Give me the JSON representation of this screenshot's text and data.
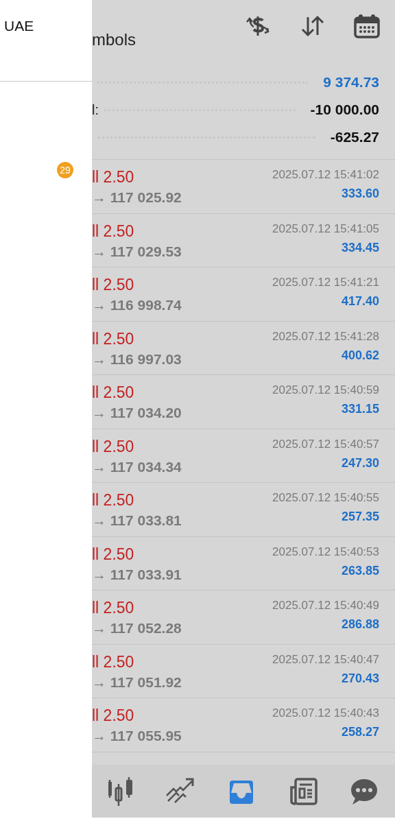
{
  "drawer": {
    "title": "UAE",
    "badge": "29"
  },
  "header": {
    "title": "mbols",
    "actions": [
      {
        "kind": "currency"
      },
      {
        "kind": "sort"
      },
      {
        "kind": "calendar"
      }
    ]
  },
  "summary": [
    {
      "value": "9 374.73",
      "kind": "accent"
    },
    {
      "label": "l:",
      "value": "-10 000.00",
      "kind": "plain"
    },
    {
      "value": "-625.27",
      "kind": "plain"
    }
  ],
  "trades": [
    {
      "type": "ll 2.50",
      "prices": "→ 117 025.92",
      "time": "2025.07.12 15:41:02",
      "profit": "333.60"
    },
    {
      "type": "ll 2.50",
      "prices": "→ 117 029.53",
      "time": "2025.07.12 15:41:05",
      "profit": "334.45"
    },
    {
      "type": "ll 2.50",
      "prices": "→ 116 998.74",
      "time": "2025.07.12 15:41:21",
      "profit": "417.40"
    },
    {
      "type": "ll 2.50",
      "prices": "→ 116 997.03",
      "time": "2025.07.12 15:41:28",
      "profit": "400.62"
    },
    {
      "type": "ll 2.50",
      "prices": "→ 117 034.20",
      "time": "2025.07.12 15:40:59",
      "profit": "331.15"
    },
    {
      "type": "ll 2.50",
      "prices": "→ 117 034.34",
      "time": "2025.07.12 15:40:57",
      "profit": "247.30"
    },
    {
      "type": "ll 2.50",
      "prices": "→ 117 033.81",
      "time": "2025.07.12 15:40:55",
      "profit": "257.35"
    },
    {
      "type": "ll 2.50",
      "prices": "→ 117 033.91",
      "time": "2025.07.12 15:40:53",
      "profit": "263.85"
    },
    {
      "type": "ll 2.50",
      "prices": "→ 117 052.28",
      "time": "2025.07.12 15:40:49",
      "profit": "286.88"
    },
    {
      "type": "ll 2.50",
      "prices": "→ 117 051.92",
      "time": "2025.07.12 15:40:47",
      "profit": "270.43"
    },
    {
      "type": "ll 2.50",
      "prices": "→ 117 055.95",
      "time": "2025.07.12 15:40:43",
      "profit": "258.27"
    }
  ],
  "nav": [
    {
      "kind": "candles",
      "selected": false
    },
    {
      "kind": "trend",
      "selected": false
    },
    {
      "kind": "inbox",
      "selected": true
    },
    {
      "kind": "news",
      "selected": false
    },
    {
      "kind": "chat",
      "selected": false
    }
  ]
}
